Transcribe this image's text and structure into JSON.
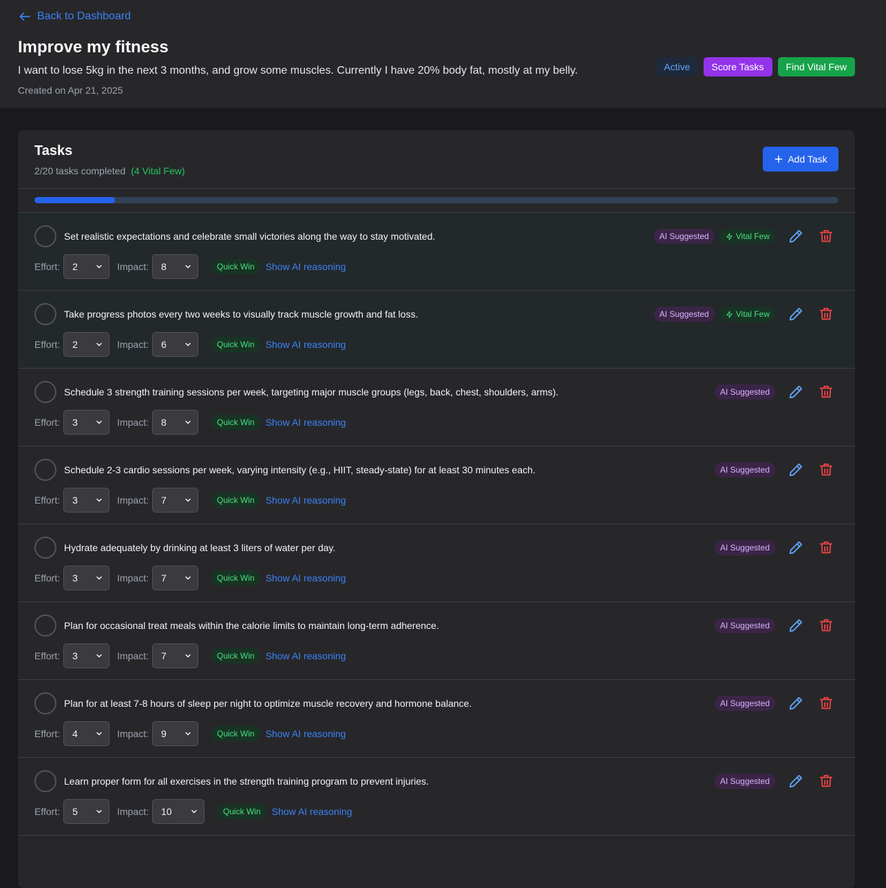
{
  "nav": {
    "back_label": "Back to Dashboard"
  },
  "goal": {
    "title": "Improve my fitness",
    "description": "I want to lose 5kg in the next 3 months, and grow some muscles. Currently I have 20% body fat, mostly at my belly.",
    "created": "Created on Apr 21, 2025",
    "status": "Active",
    "score_label": "Score Tasks",
    "vital_label": "Find Vital Few"
  },
  "tasks_panel": {
    "title": "Tasks",
    "completed_text": "2/20 tasks completed",
    "vital_text": "(4 Vital Few)",
    "add_label": "Add Task",
    "progress": 0.1
  },
  "labels": {
    "effort": "Effort:",
    "impact": "Impact:",
    "quick_win": "Quick Win",
    "show_reasoning": "Show AI reasoning",
    "ai_suggested": "AI Suggested",
    "vital_few": "Vital Few"
  },
  "tasks": [
    {
      "text": "Set realistic expectations and celebrate small victories along the way to stay motivated.",
      "effort": "2",
      "impact": "8",
      "vital": true
    },
    {
      "text": "Take progress photos every two weeks to visually track muscle growth and fat loss.",
      "effort": "2",
      "impact": "6",
      "vital": true
    },
    {
      "text": "Schedule 3 strength training sessions per week, targeting major muscle groups (legs, back, chest, shoulders, arms).",
      "effort": "3",
      "impact": "8",
      "vital": false
    },
    {
      "text": "Schedule 2-3 cardio sessions per week, varying intensity (e.g., HIIT, steady-state) for at least 30 minutes each.",
      "effort": "3",
      "impact": "7",
      "vital": false
    },
    {
      "text": "Hydrate adequately by drinking at least 3 liters of water per day.",
      "effort": "3",
      "impact": "7",
      "vital": false
    },
    {
      "text": "Plan for occasional treat meals within the calorie limits to maintain long-term adherence.",
      "effort": "3",
      "impact": "7",
      "vital": false
    },
    {
      "text": "Plan for at least 7-8 hours of sleep per night to optimize muscle recovery and hormone balance.",
      "effort": "4",
      "impact": "9",
      "vital": false
    },
    {
      "text": "Learn proper form for all exercises in the strength training program to prevent injuries.",
      "effort": "5",
      "impact": "10",
      "vital": false
    }
  ],
  "colors": {
    "accent": "#2563eb",
    "purple": "#9333ea",
    "green": "#16a34a",
    "danger": "#ef4444"
  }
}
